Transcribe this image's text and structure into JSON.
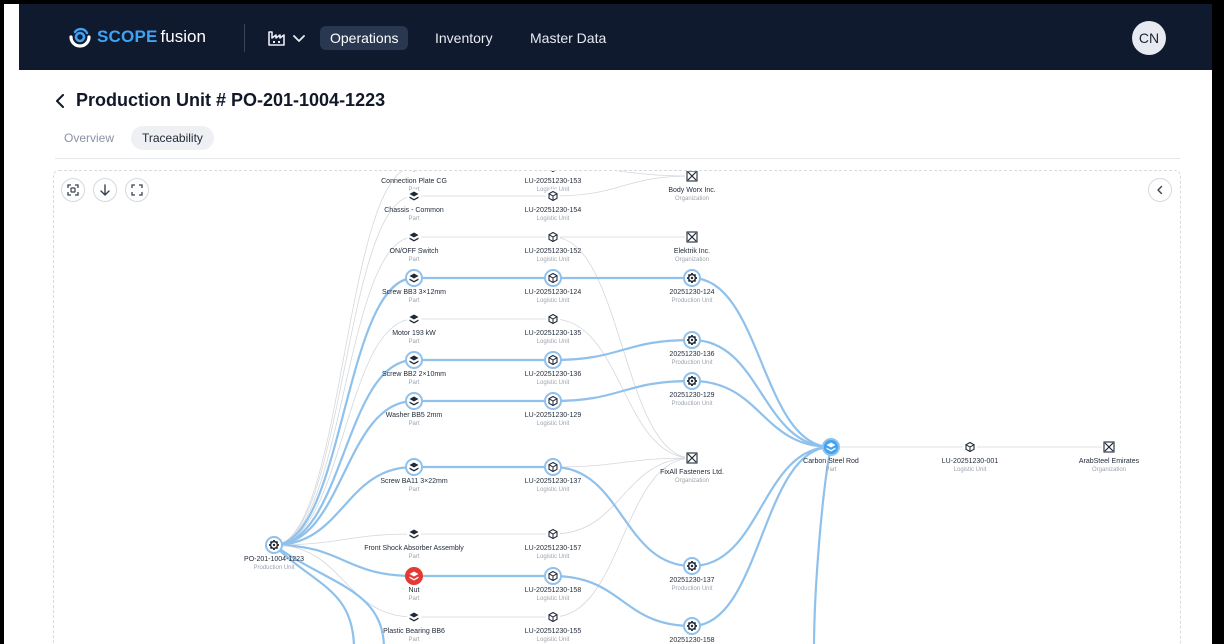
{
  "header": {
    "logo_brand": "SCOPE",
    "logo_suffix": "fusion",
    "nav": [
      {
        "label": "Operations",
        "active": true
      },
      {
        "label": "Inventory",
        "active": false
      },
      {
        "label": "Master Data",
        "active": false
      }
    ],
    "avatar_initials": "CN"
  },
  "page": {
    "title": "Production Unit # PO-201-1004-1223",
    "tabs": [
      {
        "label": "Overview",
        "active": false
      },
      {
        "label": "Traceability",
        "active": true
      }
    ]
  },
  "colors": {
    "accent": "#3fa3f5",
    "edge_highlight": "#8fc1ec",
    "edge_muted": "#d4d7dc",
    "alert": "#e53935",
    "header_bg": "#0f1a2e"
  },
  "graph": {
    "nodes": [
      {
        "id": "root",
        "kind": "gear",
        "label": "PO-201-1004-1223",
        "sub": "Production Unit"
      },
      {
        "id": "p0",
        "kind": "part",
        "label": "Connection Plate CG",
        "sub": "Part"
      },
      {
        "id": "p1",
        "kind": "part",
        "label": "Chassis - Common",
        "sub": "Part"
      },
      {
        "id": "p2",
        "kind": "part",
        "label": "ON/OFF Switch",
        "sub": "Part"
      },
      {
        "id": "p3",
        "kind": "part",
        "label": "Screw BB3 3×12mm",
        "sub": "Part",
        "highlight": true
      },
      {
        "id": "p4",
        "kind": "part",
        "label": "Motor 193 kW",
        "sub": "Part"
      },
      {
        "id": "p5",
        "kind": "part",
        "label": "Screw BB2 2×10mm",
        "sub": "Part",
        "highlight": true
      },
      {
        "id": "p6",
        "kind": "part",
        "label": "Washer BB5 2mm",
        "sub": "Part",
        "highlight": true
      },
      {
        "id": "p7",
        "kind": "part",
        "label": "Screw BA11 3×22mm",
        "sub": "Part",
        "highlight": true
      },
      {
        "id": "p8",
        "kind": "part",
        "label": "Front Shock Absorber Assembly",
        "sub": "Part"
      },
      {
        "id": "p9",
        "kind": "part",
        "label": "Nut",
        "sub": "Part",
        "alert": true,
        "highlight": true
      },
      {
        "id": "p10",
        "kind": "part",
        "label": "Plastic Bearing BB6",
        "sub": "Part"
      },
      {
        "id": "l0",
        "kind": "box",
        "label": "LU-20251230-153",
        "sub": "Logistic Unit"
      },
      {
        "id": "l1",
        "kind": "box",
        "label": "LU-20251230-154",
        "sub": "Logistic Unit"
      },
      {
        "id": "l2",
        "kind": "box",
        "label": "LU-20251230-152",
        "sub": "Logistic Unit"
      },
      {
        "id": "l3",
        "kind": "box",
        "label": "LU-20251230-124",
        "sub": "Logistic Unit",
        "highlight": true
      },
      {
        "id": "l4",
        "kind": "box",
        "label": "LU-20251230-135",
        "sub": "Logistic Unit"
      },
      {
        "id": "l5",
        "kind": "box",
        "label": "LU-20251230-136",
        "sub": "Logistic Unit",
        "highlight": true
      },
      {
        "id": "l6",
        "kind": "box",
        "label": "LU-20251230-129",
        "sub": "Logistic Unit",
        "highlight": true
      },
      {
        "id": "l7",
        "kind": "box",
        "label": "LU-20251230-137",
        "sub": "Logistic Unit",
        "highlight": true
      },
      {
        "id": "l8",
        "kind": "box",
        "label": "LU-20251230-157",
        "sub": "Logistic Unit"
      },
      {
        "id": "l9",
        "kind": "box",
        "label": "LU-20251230-158",
        "sub": "Logistic Unit",
        "highlight": true
      },
      {
        "id": "l10",
        "kind": "box",
        "label": "LU-20251230-155",
        "sub": "Logistic Unit"
      },
      {
        "id": "o1",
        "kind": "org",
        "label": "Body Worx Inc.",
        "sub": "Organization"
      },
      {
        "id": "o2",
        "kind": "org",
        "label": "Elektrik Inc.",
        "sub": "Organization"
      },
      {
        "id": "o3",
        "kind": "org",
        "label": "FixAll Fasteners Ltd.",
        "sub": "Organization"
      },
      {
        "id": "u1",
        "kind": "gear",
        "label": "20251230-124",
        "sub": "Production Unit",
        "highlight": true
      },
      {
        "id": "u2",
        "kind": "gear",
        "label": "20251230-136",
        "sub": "Production Unit",
        "highlight": true
      },
      {
        "id": "u3",
        "kind": "gear",
        "label": "20251230-129",
        "sub": "Production Unit",
        "highlight": true
      },
      {
        "id": "u4",
        "kind": "gear",
        "label": "20251230-137",
        "sub": "Production Unit",
        "highlight": true
      },
      {
        "id": "u5",
        "kind": "gear",
        "label": "20251230-158",
        "sub": "Production Unit",
        "highlight": true
      },
      {
        "id": "csr",
        "kind": "part",
        "label": "Carbon Steel Rod",
        "sub": "Part",
        "highlight": true,
        "focus": true
      },
      {
        "id": "l11",
        "kind": "box",
        "label": "LU-20251230-001",
        "sub": "Logistic Unit"
      },
      {
        "id": "o4",
        "kind": "org",
        "label": "ArabSteel Emirates",
        "sub": "Organization"
      }
    ],
    "edges": [
      [
        "root",
        "p0",
        0
      ],
      [
        "root",
        "p1",
        0
      ],
      [
        "root",
        "p2",
        0
      ],
      [
        "root",
        "p3",
        1
      ],
      [
        "root",
        "p4",
        0
      ],
      [
        "root",
        "p5",
        1
      ],
      [
        "root",
        "p6",
        1
      ],
      [
        "root",
        "p7",
        1
      ],
      [
        "root",
        "p8",
        0
      ],
      [
        "root",
        "p9",
        1
      ],
      [
        "root",
        "p10",
        0
      ],
      [
        "p0",
        "l0",
        0
      ],
      [
        "p1",
        "l1",
        0
      ],
      [
        "p2",
        "l2",
        0
      ],
      [
        "p3",
        "l3",
        1
      ],
      [
        "p4",
        "l4",
        0
      ],
      [
        "p5",
        "l5",
        1
      ],
      [
        "p6",
        "l6",
        1
      ],
      [
        "p7",
        "l7",
        1
      ],
      [
        "p8",
        "l8",
        0
      ],
      [
        "p9",
        "l9",
        1
      ],
      [
        "p10",
        "l10",
        0
      ],
      [
        "l0",
        "o1",
        0
      ],
      [
        "l1",
        "o1",
        0
      ],
      [
        "l2",
        "o2",
        0
      ],
      [
        "l4",
        "o3",
        0
      ],
      [
        "l8",
        "o3",
        0
      ],
      [
        "l10",
        "o3",
        0
      ],
      [
        "l2",
        "o3",
        0
      ],
      [
        "l7",
        "o3",
        0
      ],
      [
        "l3",
        "u1",
        1
      ],
      [
        "l5",
        "u2",
        1
      ],
      [
        "l6",
        "u3",
        1
      ],
      [
        "l7",
        "u4",
        1
      ],
      [
        "l9",
        "u5",
        1
      ],
      [
        "u1",
        "csr",
        1
      ],
      [
        "u2",
        "csr",
        1
      ],
      [
        "u3",
        "csr",
        1
      ],
      [
        "u4",
        "csr",
        1
      ],
      [
        "u5",
        "csr",
        1
      ],
      [
        "csr",
        "l11",
        0
      ],
      [
        "l11",
        "o4",
        0
      ]
    ]
  }
}
